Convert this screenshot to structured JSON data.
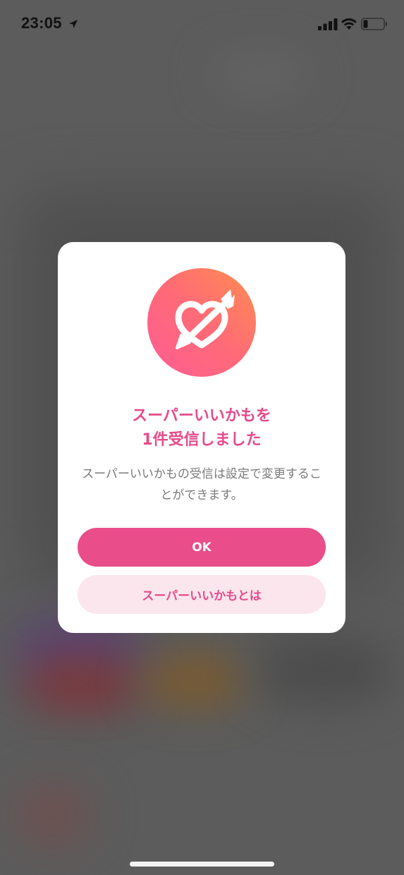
{
  "status_bar": {
    "time": "23:05",
    "icons": [
      "location-icon",
      "signal-icon",
      "wifi-icon",
      "battery-icon"
    ]
  },
  "dialog": {
    "icon": "heart-arrow-icon",
    "title_line1": "スーパーいいかもを",
    "title_line2": "1件受信しました",
    "message": "スーパーいいかもの受信は設定で変更することができます。",
    "primary_button": "OK",
    "secondary_button": "スーパーいいかもとは"
  },
  "colors": {
    "accent": "#e94d8a",
    "accent_light": "#fce6ee",
    "gradient_start": "#ff8e4f",
    "gradient_end": "#ff5d94",
    "overlay": "#5c5c5c"
  }
}
